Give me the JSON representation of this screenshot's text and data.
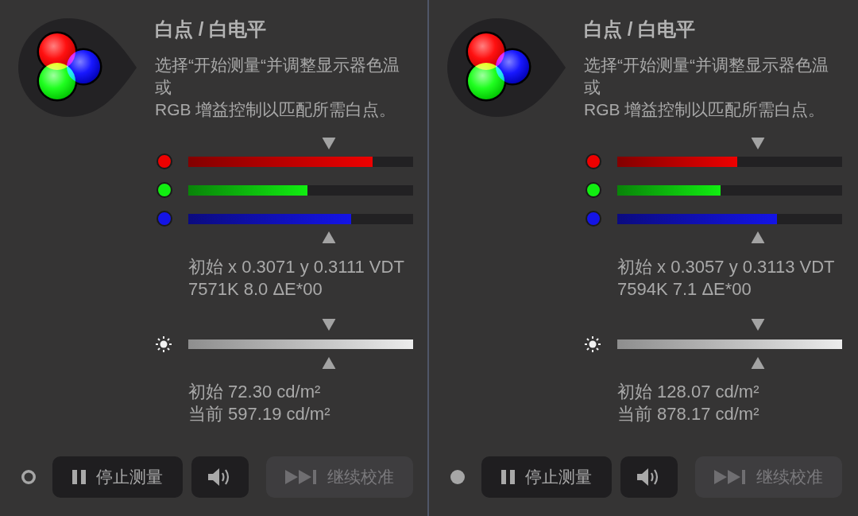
{
  "panels": [
    {
      "title": "白点 / 白电平",
      "description": [
        "选择“开始测量“并调整显示器色温",
        "或",
        "RGB 增益控制以匹配所需白点。"
      ],
      "rgb": {
        "target": {
          "level": 0.625
        },
        "channels": [
          {
            "color": "#ee0000",
            "level": 0.82
          },
          {
            "color": "#11ee11",
            "level": 0.53
          },
          {
            "color": "#1414e6",
            "level": 0.725
          }
        ]
      },
      "chromaticity": [
        "初始 x 0.3071 y 0.3111 VDT",
        "7571K 8.0 ΔE*00"
      ],
      "luminance": {
        "target": {
          "level": 0.625
        },
        "level": 1
      },
      "luminance_readings": [
        "初始 72.30 cd/m²",
        "当前 597.19 cd/m²"
      ],
      "status_indicator": {
        "filled": false
      },
      "buttons": [
        {
          "kind": "pause",
          "label": "停止测量",
          "disabled": false
        },
        {
          "kind": "sound",
          "disabled": false
        },
        {
          "kind": "skip",
          "label": "继续校准",
          "disabled": true
        }
      ]
    },
    {
      "title": "白点 / 白电平",
      "description": [
        "选择“开始测量“并调整显示器色温",
        "或",
        "RGB 增益控制以匹配所需白点。"
      ],
      "rgb": {
        "target": {
          "level": 0.625
        },
        "channels": [
          {
            "color": "#ee0000",
            "level": 0.535
          },
          {
            "color": "#11ee11",
            "level": 0.46
          },
          {
            "color": "#1414e6",
            "level": 0.71
          }
        ]
      },
      "chromaticity": [
        "初始 x 0.3057 y 0.3113 VDT",
        "7594K 7.1 ΔE*00"
      ],
      "luminance": {
        "target": {
          "level": 0.625
        },
        "level": 1
      },
      "luminance_readings": [
        "初始 128.07 cd/m²",
        "当前 878.17 cd/m²"
      ],
      "status_indicator": {
        "filled": true
      },
      "buttons": [
        {
          "kind": "pause",
          "label": "停止测量",
          "disabled": false
        },
        {
          "kind": "sound",
          "disabled": false
        },
        {
          "kind": "skip",
          "label": "继续校准",
          "disabled": true
        }
      ]
    }
  ]
}
